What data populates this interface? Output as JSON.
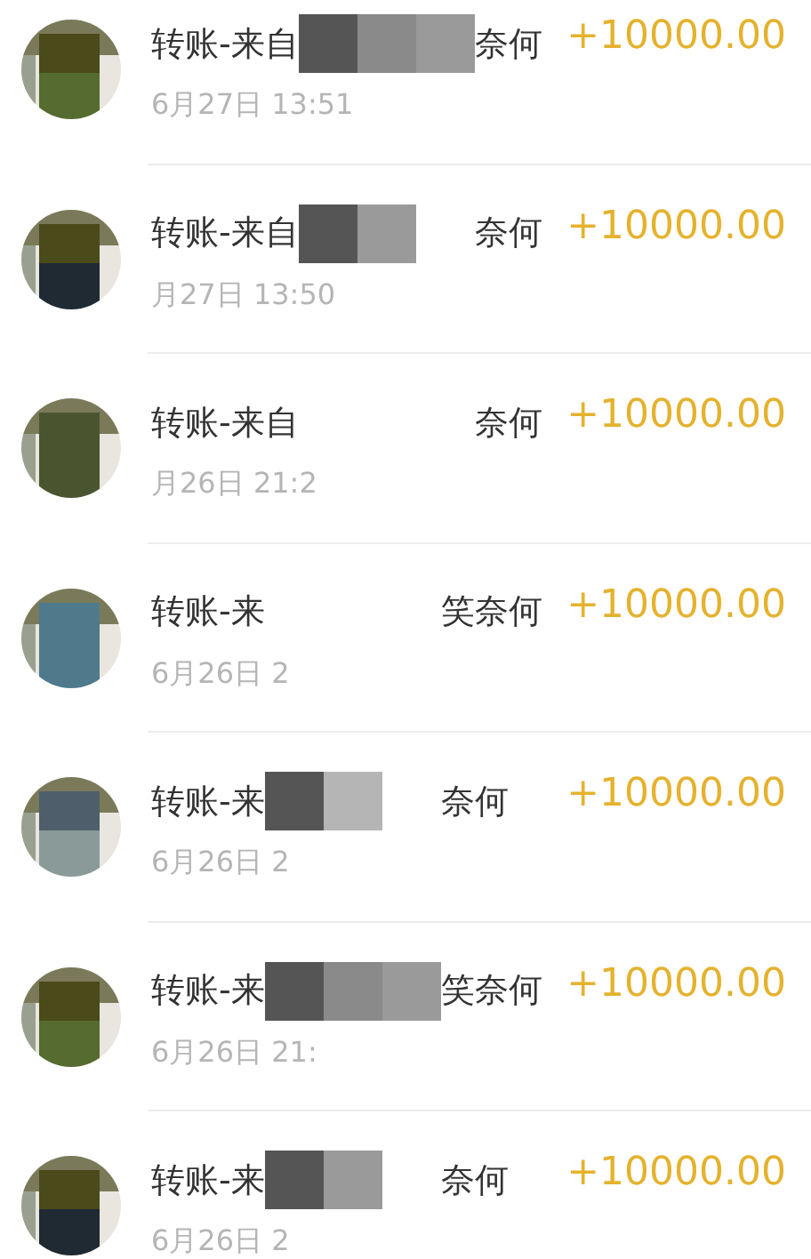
{
  "transactions": [
    {
      "title_start": "转账-来自",
      "title_end": "奈何",
      "mosaic": [
        {
          "color": "#555555"
        },
        {
          "color": "#8a8a8a"
        },
        {
          "color": "#9a9a9a"
        }
      ],
      "date": "6月27日 13:51",
      "amount": "+10000.00"
    },
    {
      "title_start": "转账-来自",
      "title_end": "奈何",
      "mosaic": [
        {
          "color": "#555555"
        },
        {
          "color": "#9a9a9a"
        }
      ],
      "date": "月27日 13:50",
      "amount": "+10000.00"
    },
    {
      "title_start": "转账-来自",
      "title_end": "奈何",
      "date": "月26日 21:2",
      "amount": "+10000.00"
    },
    {
      "title_start": "转账-来",
      "title_end": "笑奈何",
      "date": "6月26日 2",
      "amount": "+10000.00"
    },
    {
      "title_start": "转账-来",
      "title_end": "奈何",
      "mosaic": [
        {
          "color": "#555555"
        },
        {
          "color": "#b5b5b5"
        }
      ],
      "date": "6月26日 2",
      "amount": "+10000.00"
    },
    {
      "title_start": "转账-来",
      "title_end": "笑奈何",
      "mosaic": [
        {
          "color": "#555555"
        },
        {
          "color": "#8a8a8a"
        },
        {
          "color": "#9a9a9a"
        }
      ],
      "date": "6月26日 21:",
      "amount": "+10000.00"
    },
    {
      "title_start": "转账-来",
      "title_end": "奈何",
      "mosaic": [
        {
          "color": "#555555"
        },
        {
          "color": "#9a9a9a"
        }
      ],
      "date": "6月26日 2",
      "amount": "+10000.00"
    }
  ]
}
